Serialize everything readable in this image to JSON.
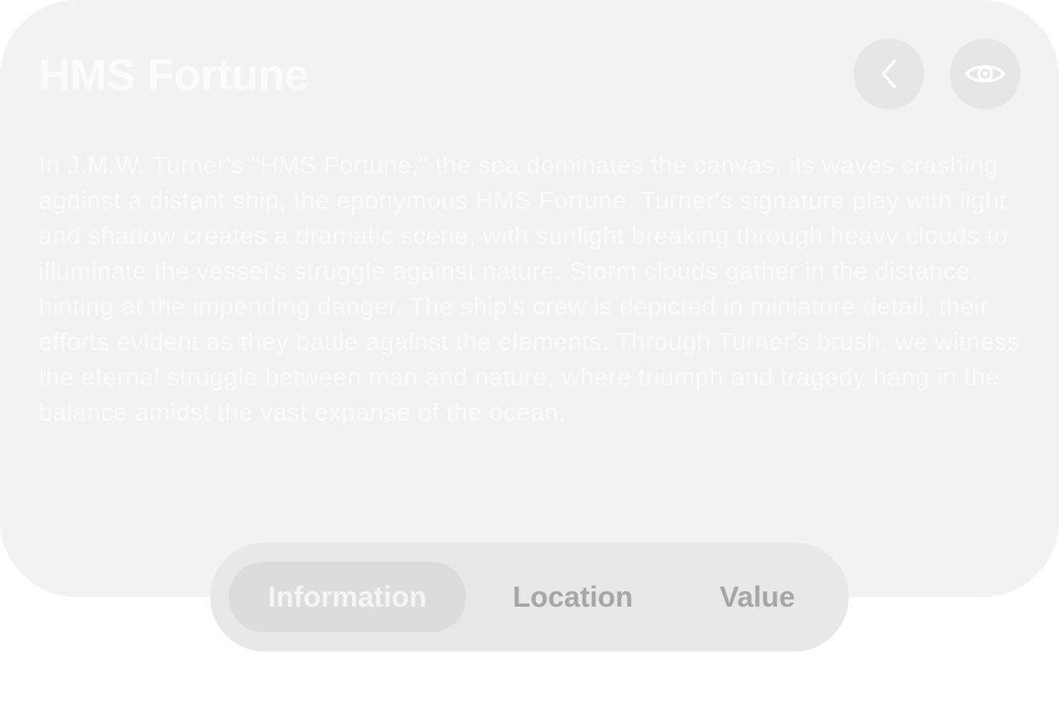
{
  "card": {
    "title": "HMS Fortune",
    "description": "In J.M.W. Turner's \"HMS Fortune,\" the sea dominates the canvas, its waves crashing against a distant ship, the eponymous HMS Fortune. Turner's signature play with light and shadow creates a dramatic scene, with sunlight breaking through heavy clouds to illuminate the vessel's struggle against nature. Storm clouds gather in the distance, hinting at the impending danger. The ship's crew is depicted in miniature detail, their efforts evident as they battle against the elements. Through Turner's brush, we witness the eternal struggle between man and nature, where triumph and tragedy hang in the balance amidst the vast expanse of the ocean."
  },
  "header_buttons": [
    {
      "icon": "chevron-left-icon"
    },
    {
      "icon": "eye-icon"
    }
  ],
  "tabs": [
    {
      "label": "Information",
      "selected": true
    },
    {
      "label": "Location",
      "selected": false
    },
    {
      "label": "Value",
      "selected": false
    }
  ],
  "colors": {
    "card_background": "#f2f2f2",
    "button_background": "#e6e6e6",
    "tabbar_background": "#e8e8e8",
    "selected_tab_background": "#dcdcdc",
    "title_text": "#fbfbfb",
    "inactive_tab_text": "#a6a6a6"
  }
}
